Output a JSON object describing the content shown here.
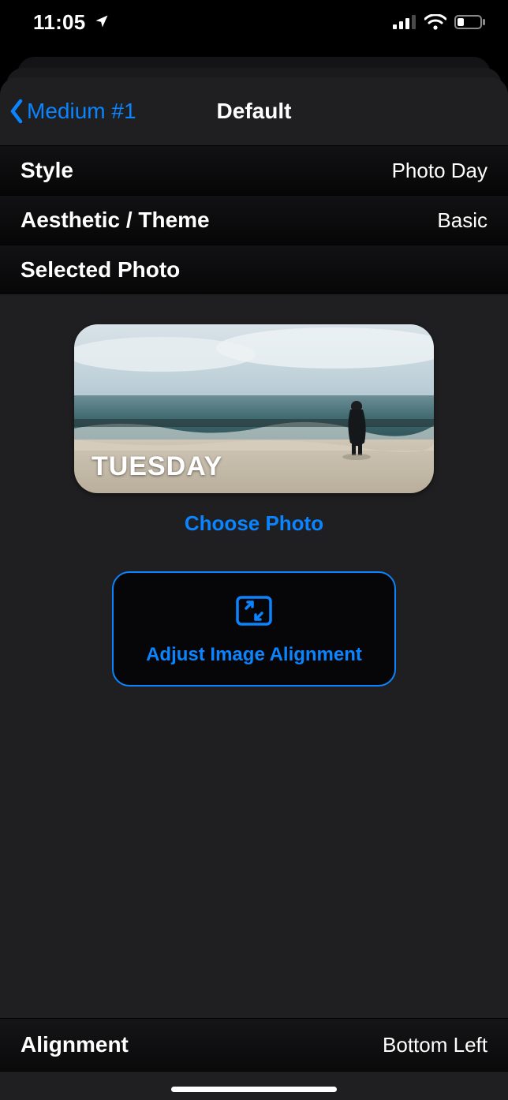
{
  "status": {
    "time": "11:05",
    "location_icon": "location-arrow-icon",
    "cell_bars": 3,
    "wifi": true,
    "battery_low": true
  },
  "nav": {
    "back_label": "Medium #1",
    "title": "Default"
  },
  "rows": {
    "style": {
      "label": "Style",
      "value": "Photo Day"
    },
    "theme": {
      "label": "Aesthetic / Theme",
      "value": "Basic"
    },
    "selected_photo": {
      "label": "Selected Photo"
    }
  },
  "preview": {
    "day_text": "TUESDAY"
  },
  "actions": {
    "choose_photo": "Choose Photo",
    "adjust_alignment": "Adjust Image Alignment"
  },
  "alignment": {
    "label": "Alignment",
    "value": "Bottom Left"
  }
}
